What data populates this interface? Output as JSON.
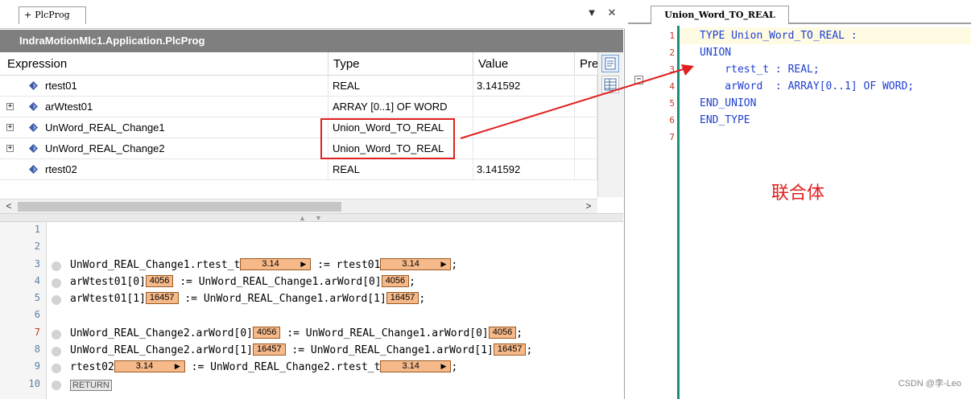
{
  "left_pane": {
    "tab_label": "PlcProg",
    "title": "IndraMotionMlc1.Application.PlcProg",
    "columns": [
      "Expression",
      "Type",
      "Value",
      "Pre"
    ],
    "rows": [
      {
        "expression": "rtest01",
        "type": "REAL",
        "value": "3.141592",
        "expandable": false
      },
      {
        "expression": "arWtest01",
        "type": "ARRAY [0..1] OF WORD",
        "value": "",
        "expandable": true
      },
      {
        "expression": "UnWord_REAL_Change1",
        "type": "Union_Word_TO_REAL",
        "value": "",
        "expandable": true
      },
      {
        "expression": "UnWord_REAL_Change2",
        "type": "Union_Word_TO_REAL",
        "value": "",
        "expandable": true
      },
      {
        "expression": "rtest02",
        "type": "REAL",
        "value": "3.141592",
        "expandable": false
      }
    ],
    "code": {
      "line_numbers": [
        "1",
        "2",
        "3",
        "4",
        "5",
        "6",
        "7",
        "8",
        "9",
        "10"
      ],
      "lines": {
        "l3": {
          "a": "UnWord_REAL_Change1.rtest_t",
          "ov1": "3.14",
          "b": " := rtest01",
          "ov2": "3.14",
          "c": ";"
        },
        "l4": {
          "a": "arWtest01[0]",
          "ov1": "4056",
          "b": " := UnWord_REAL_Change1.arWord[0]",
          "ov2": "4056",
          "c": ";"
        },
        "l5": {
          "a": "arWtest01[1]",
          "ov1": "16457",
          "b": " := UnWord_REAL_Change1.arWord[1]",
          "ov2": "16457",
          "c": ";"
        },
        "l7": {
          "a": "UnWord_REAL_Change2.arWord[0]",
          "ov1": "4056",
          "b": " := UnWord_REAL_Change1.arWord[0]",
          "ov2": "4056",
          "c": ";"
        },
        "l8": {
          "a": "UnWord_REAL_Change2.arWord[1]",
          "ov1": "16457",
          "b": " := UnWord_REAL_Change1.arWord[1]",
          "ov2": "16457",
          "c": ";"
        },
        "l9": {
          "a": "rtest02",
          "ov1": "3.14",
          "b": " := UnWord_REAL_Change2.rtest_t",
          "ov2": "3.14",
          "c": ";"
        },
        "l10": {
          "ret": "RETURN"
        }
      }
    }
  },
  "right_pane": {
    "tab_label": "Union_Word_TO_REAL",
    "line_numbers": [
      "1",
      "2",
      "3",
      "4",
      "5",
      "6",
      "7"
    ],
    "lines": [
      "TYPE Union_Word_TO_REAL :",
      "UNION",
      "    rtest_t : REAL;",
      "    arWord  : ARRAY[0..1] OF WORD;",
      "END_UNION",
      "END_TYPE",
      ""
    ],
    "annotation": "联合体"
  },
  "watermark": "CSDN @李-Leo",
  "colors": {
    "highlight": "#e02020",
    "keyword": "#1f3fd1",
    "overlay_box": "#f5b98a",
    "title_bar": "#7f7f7f"
  }
}
